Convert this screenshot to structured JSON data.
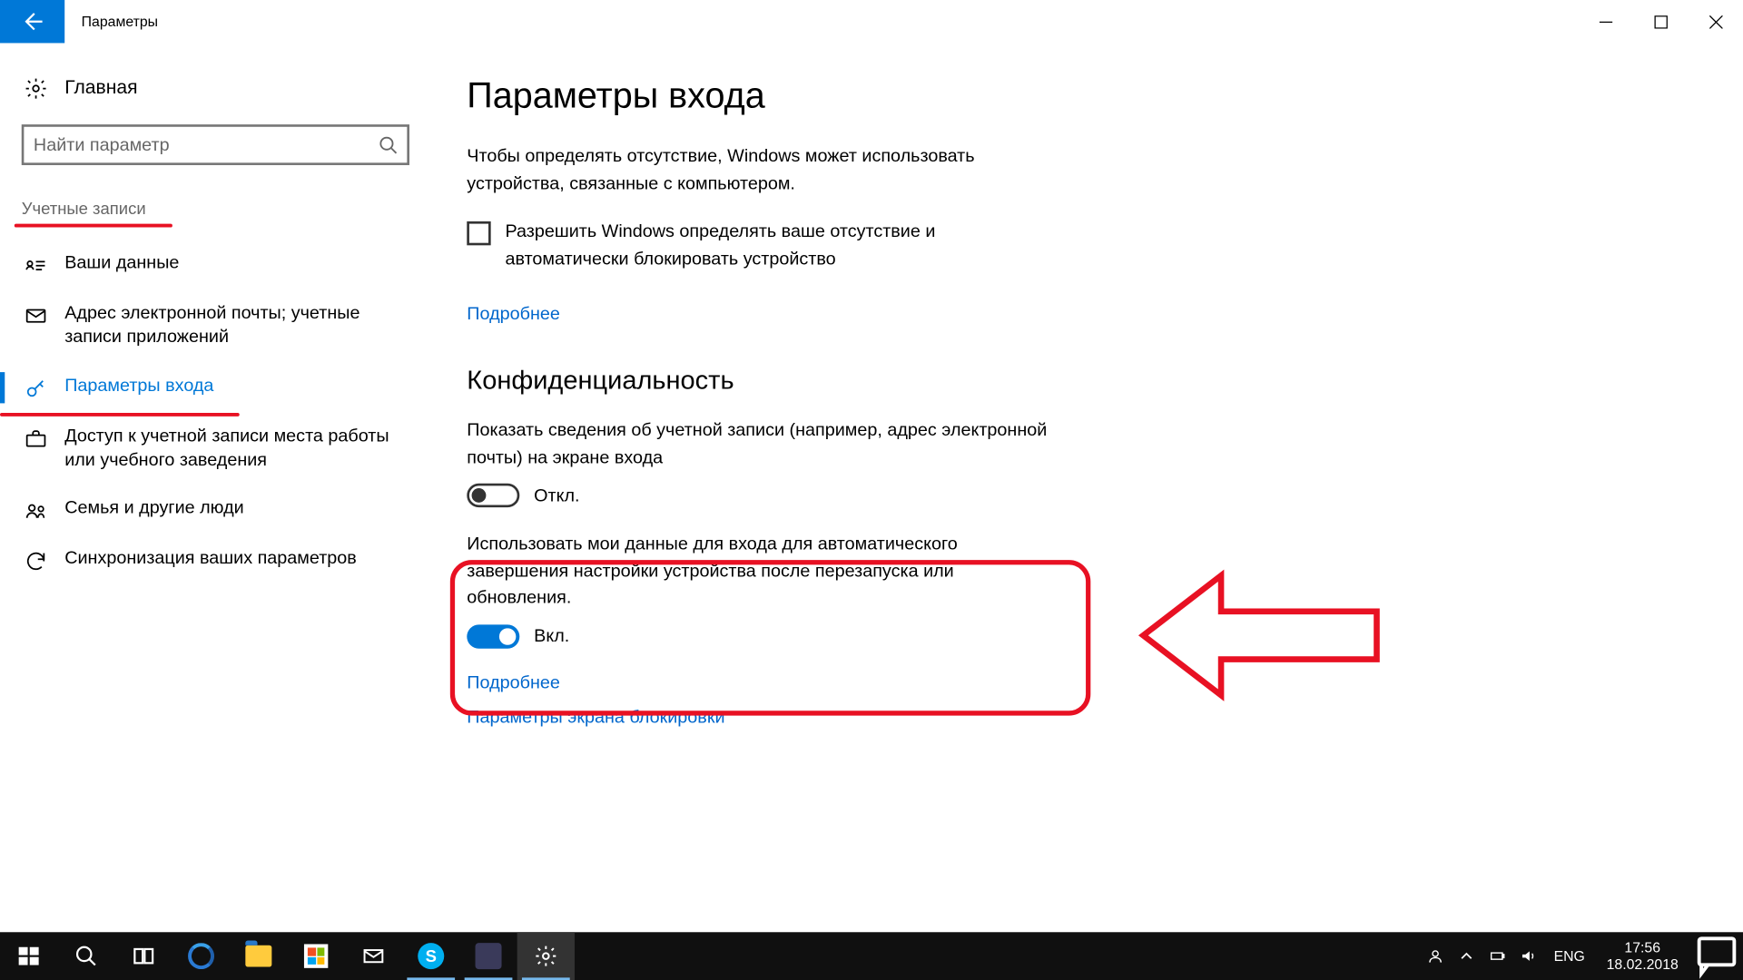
{
  "titlebar": {
    "title": "Параметры"
  },
  "sidebar": {
    "home": "Главная",
    "search_placeholder": "Найти параметр",
    "section": "Учетные записи",
    "items": [
      {
        "label": "Ваши данные"
      },
      {
        "label": "Адрес электронной почты; учетные записи приложений"
      },
      {
        "label": "Параметры входа"
      },
      {
        "label": "Доступ к учетной записи места работы или учебного заведения"
      },
      {
        "label": "Семья и другие люди"
      },
      {
        "label": "Синхронизация ваших параметров"
      }
    ]
  },
  "main": {
    "heading": "Параметры входа",
    "absence_desc": "Чтобы определять отсутствие, Windows может использовать устройства, связанные с компьютером.",
    "absence_checkbox": "Разрешить Windows определять ваше отсутствие и автоматически блокировать устройство",
    "more1": "Подробнее",
    "privacy_heading": "Конфиденциальность",
    "privacy_setting1": "Показать сведения об учетной записи (например, адрес электронной почты) на экране входа",
    "toggle1_state": "Откл.",
    "privacy_setting2": "Использовать мои данные для входа для автоматического завершения настройки устройства после перезапуска или обновления.",
    "toggle2_state": "Вкл.",
    "more2": "Подробнее",
    "lockscreen_link": "Параметры экрана блокировки"
  },
  "taskbar": {
    "lang": "ENG",
    "time": "17:56",
    "date": "18.02.2018"
  }
}
